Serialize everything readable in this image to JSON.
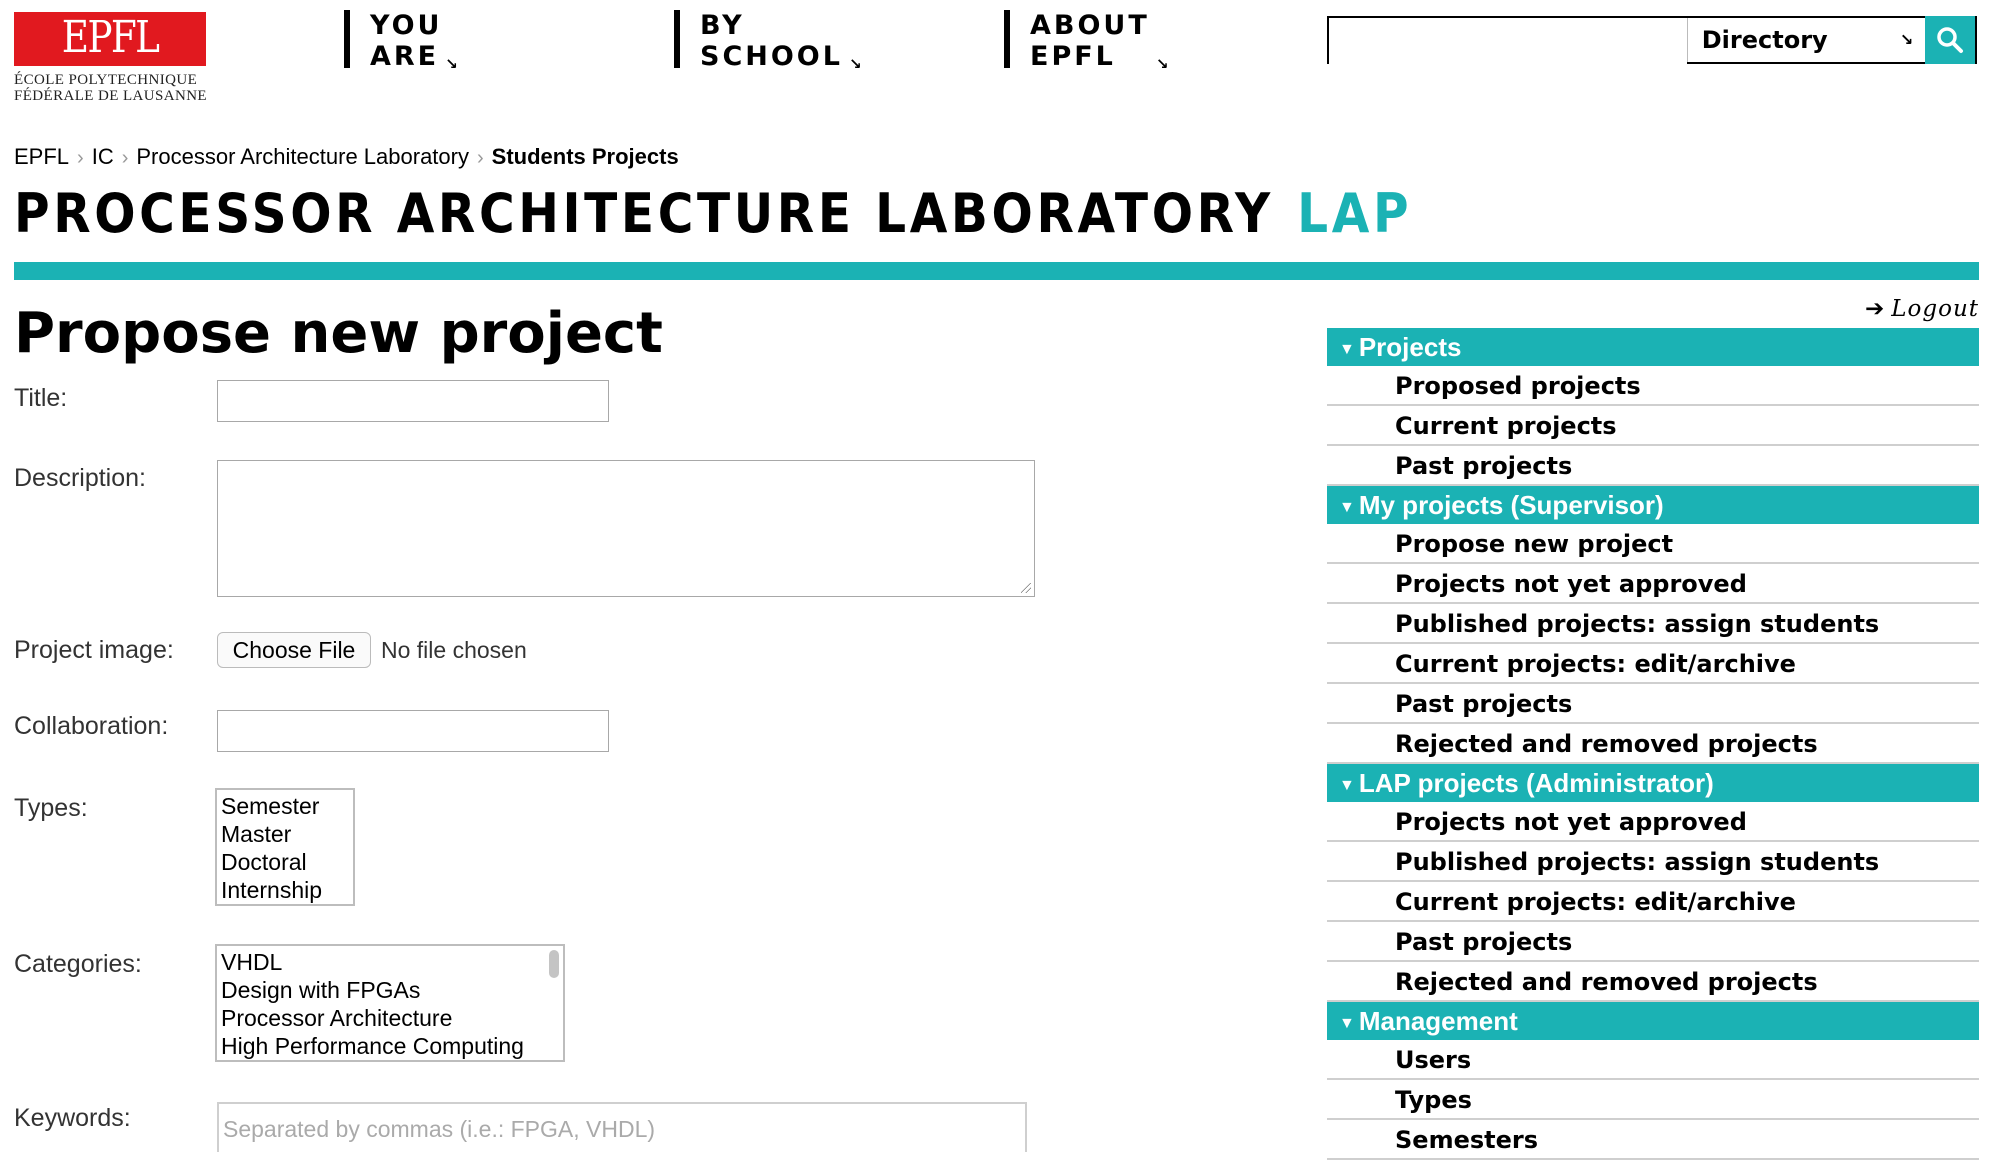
{
  "logo": {
    "mark": "EPFL",
    "line1": "ÉCOLE POLYTECHNIQUE",
    "line2": "FÉDÉRALE DE LAUSANNE"
  },
  "topnav": [
    {
      "line1": "YOU",
      "line2": "ARE"
    },
    {
      "line1": "BY",
      "line2": "SCHOOL"
    },
    {
      "line1": "ABOUT",
      "line2": "EPFL"
    }
  ],
  "search": {
    "value": "",
    "scope": "Directory",
    "icon": "search-icon"
  },
  "breadcrumb": [
    "EPFL",
    "IC",
    "Processor Architecture Laboratory",
    "Students Projects"
  ],
  "lab": {
    "name": "PROCESSOR ARCHITECTURE LABORATORY",
    "acronym": "LAP"
  },
  "form": {
    "heading": "Propose new project",
    "title_label": "Title:",
    "title_value": "",
    "description_label": "Description:",
    "description_value": "",
    "image_label": "Project image:",
    "file_button": "Choose File",
    "file_status": "No file chosen",
    "collaboration_label": "Collaboration:",
    "collaboration_value": "",
    "types_label": "Types:",
    "types": [
      "Semester",
      "Master",
      "Doctoral",
      "Internship"
    ],
    "categories_label": "Categories:",
    "categories": [
      "VHDL",
      "Design with FPGAs",
      "Processor Architecture",
      "High Performance Computing"
    ],
    "keywords_label": "Keywords:",
    "keywords_placeholder": "Separated by commas (i.e.: FPGA, VHDL)"
  },
  "logout": "Logout",
  "menu": [
    {
      "title": "Projects",
      "items": [
        "Proposed projects",
        "Current projects",
        "Past projects"
      ]
    },
    {
      "title": "My projects (Supervisor)",
      "items": [
        "Propose new project",
        "Projects not yet approved",
        "Published projects: assign students",
        "Current projects: edit/archive",
        "Past projects",
        "Rejected and removed projects"
      ]
    },
    {
      "title": "LAP projects (Administrator)",
      "items": [
        "Projects not yet approved",
        "Published projects: assign students",
        "Current projects: edit/archive",
        "Past projects",
        "Rejected and removed projects"
      ]
    },
    {
      "title": "Management",
      "items": [
        "Users",
        "Types",
        "Semesters"
      ]
    }
  ],
  "colors": {
    "accent": "#1bb2b4",
    "brand_red": "#e1191f"
  }
}
